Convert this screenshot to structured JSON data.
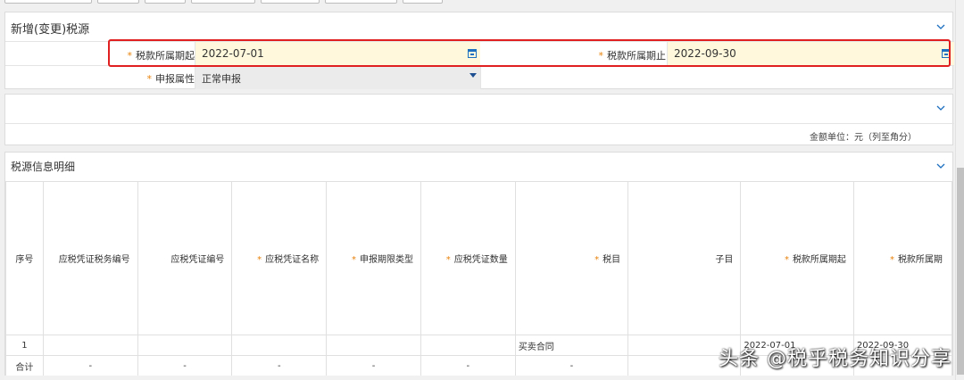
{
  "form": {
    "title": "新增(变更)税源",
    "start_label": "税款所属期起",
    "start_value": "2022-07-01",
    "end_label": "税款所属期止",
    "end_value": "2022-09-30",
    "attr_label": "申报属性",
    "attr_value": "正常申报",
    "required_mark": "*"
  },
  "summary": {
    "unit": "金额单位：元（列至角分）"
  },
  "detail": {
    "title": "税源信息明细",
    "headers": [
      {
        "text": "序号",
        "required": false
      },
      {
        "text": "应税凭证税务编号",
        "required": false
      },
      {
        "text": "应税凭证编号",
        "required": false
      },
      {
        "text": "应税凭证名称",
        "required": true
      },
      {
        "text": "申报期限类型",
        "required": true
      },
      {
        "text": "应税凭证数量",
        "required": true
      },
      {
        "text": "税目",
        "required": true
      },
      {
        "text": "子目",
        "required": false
      },
      {
        "text": "税款所属期起",
        "required": true
      },
      {
        "text": "税款所属期",
        "required": true
      }
    ],
    "row1": {
      "index": "1",
      "item": "买卖合同",
      "start": "2022-07-01",
      "end": "2022-09-30"
    },
    "total_row": {
      "label": "合计",
      "dash": "-"
    }
  },
  "watermark": "头条 @税乎税务知识分享",
  "colors": {
    "required": "#e8820c",
    "highlight_border": "#e02020",
    "date_bg": "#fff8dc",
    "accent": "#1d6fbf"
  }
}
